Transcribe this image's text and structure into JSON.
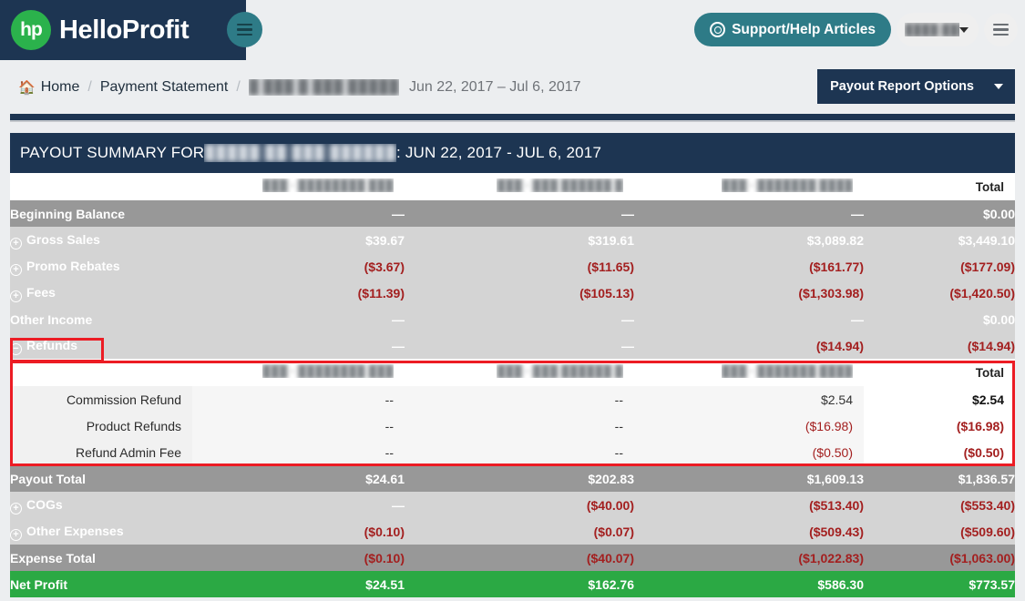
{
  "brand": {
    "logo_mark": "hp",
    "name": "HelloProfit"
  },
  "header": {
    "support_button": "Support/Help Articles",
    "user_menu_blurred": "████ █████",
    "menu_icon": "hamburger-icon"
  },
  "breadcrumb": {
    "home": "Home",
    "separator": "/",
    "payment_statement": "Payment Statement",
    "account_blurred": "█ ███ █ ███ █████",
    "date_range": "Jun 22, 2017 – Jul 6, 2017"
  },
  "toolbar": {
    "payout_report_options": "Payout Report Options"
  },
  "panel": {
    "title_prefix": "PAYOUT SUMMARY FOR ",
    "title_blurred": "█████ ██ ███ ██████",
    "title_suffix": ": JUN 22, 2017 - JUL 6, 2017"
  },
  "table": {
    "columns": [
      {
        "header_blurred": "███ · ████████ ███"
      },
      {
        "header_blurred": "███ · ███ ██████ █"
      },
      {
        "header_blurred": "███ · ███████ ████"
      }
    ],
    "total_header": "Total",
    "rows": [
      {
        "label": "Beginning Balance",
        "expander": "",
        "style": "dark",
        "values": [
          "—",
          "—",
          "—"
        ],
        "total": "$0.00",
        "value_kinds": [
          "dash",
          "dash",
          "dash"
        ],
        "total_kind": "pos"
      },
      {
        "label": "Gross Sales",
        "expander": "+",
        "style": "light",
        "values": [
          "$39.67",
          "$319.61",
          "$3,089.82"
        ],
        "total": "$3,449.10",
        "value_kinds": [
          "pos",
          "pos",
          "pos"
        ],
        "total_kind": "pos"
      },
      {
        "label": "Promo Rebates",
        "expander": "+",
        "style": "light",
        "values": [
          "($3.67)",
          "($11.65)",
          "($161.77)"
        ],
        "total": "($177.09)",
        "value_kinds": [
          "neg",
          "neg",
          "neg"
        ],
        "total_kind": "neg"
      },
      {
        "label": "Fees",
        "expander": "+",
        "style": "light",
        "values": [
          "($11.39)",
          "($105.13)",
          "($1,303.98)"
        ],
        "total": "($1,420.50)",
        "value_kinds": [
          "neg",
          "neg",
          "neg"
        ],
        "total_kind": "neg"
      },
      {
        "label": "Other Income",
        "expander": "",
        "style": "light",
        "values": [
          "—",
          "—",
          "—"
        ],
        "total": "$0.00",
        "value_kinds": [
          "dash",
          "dash",
          "dash"
        ],
        "total_kind": "pos"
      },
      {
        "label": "Refunds",
        "expander": "−",
        "style": "light",
        "values": [
          "—",
          "—",
          "($14.94)"
        ],
        "total": "($14.94)",
        "value_kinds": [
          "dash",
          "dash",
          "neg"
        ],
        "total_kind": "neg"
      }
    ],
    "refund_detail": {
      "total_header": "Total",
      "rows": [
        {
          "label": "Commission Refund",
          "values": [
            "--",
            "--",
            "$2.54"
          ],
          "total": "$2.54",
          "value_kinds": [
            "plain",
            "plain",
            "plain"
          ],
          "total_kind": "plain"
        },
        {
          "label": "Product Refunds",
          "values": [
            "--",
            "--",
            "($16.98)"
          ],
          "total": "($16.98)",
          "value_kinds": [
            "plain",
            "plain",
            "neg"
          ],
          "total_kind": "neg"
        },
        {
          "label": "Refund Admin Fee",
          "values": [
            "--",
            "--",
            "($0.50)"
          ],
          "total": "($0.50)",
          "value_kinds": [
            "plain",
            "plain",
            "neg"
          ],
          "total_kind": "neg"
        }
      ]
    },
    "footer_rows": [
      {
        "label": "Payout Total",
        "expander": "",
        "style": "dark",
        "values": [
          "$24.61",
          "$202.83",
          "$1,609.13"
        ],
        "total": "$1,836.57",
        "value_kinds": [
          "pos",
          "pos",
          "pos"
        ],
        "total_kind": "pos"
      },
      {
        "label": "COGs",
        "expander": "+",
        "style": "light",
        "values": [
          "—",
          "($40.00)",
          "($513.40)"
        ],
        "total": "($553.40)",
        "value_kinds": [
          "dash",
          "neg",
          "neg"
        ],
        "total_kind": "neg"
      },
      {
        "label": "Other Expenses",
        "expander": "+",
        "style": "light",
        "values": [
          "($0.10)",
          "($0.07)",
          "($509.43)"
        ],
        "total": "($509.60)",
        "value_kinds": [
          "neg",
          "neg",
          "neg"
        ],
        "total_kind": "neg"
      },
      {
        "label": "Expense Total",
        "expander": "",
        "style": "dark",
        "values": [
          "($0.10)",
          "($40.07)",
          "($1,022.83)"
        ],
        "total": "($1,063.00)",
        "value_kinds": [
          "neg",
          "neg",
          "neg"
        ],
        "total_kind": "neg"
      },
      {
        "label": "Net Profit",
        "expander": "",
        "style": "green",
        "values": [
          "$24.51",
          "$162.76",
          "$586.30"
        ],
        "total": "$773.57",
        "value_kinds": [
          "pos",
          "pos",
          "pos"
        ],
        "total_kind": "pos"
      }
    ]
  },
  "colors": {
    "navy": "#1d3552",
    "teal": "#2e7b87",
    "brand_green": "#2bb24c",
    "row_light": "#d4d4d4",
    "row_dark": "#989898",
    "net_profit_green": "#2ba944",
    "negative_red": "#a31f1f",
    "highlight_red": "#ec1c24"
  }
}
